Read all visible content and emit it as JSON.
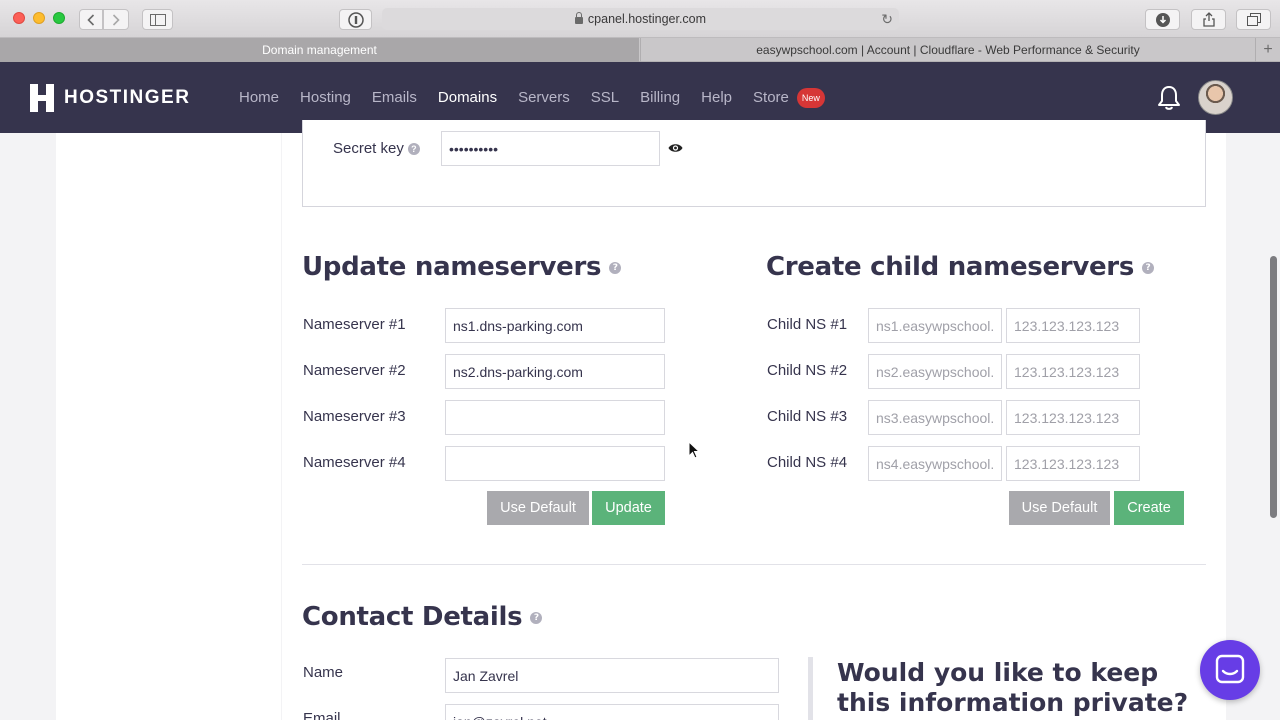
{
  "browser": {
    "url": "cpanel.hostinger.com",
    "tabs": [
      {
        "label": "Domain management",
        "active": true
      },
      {
        "label": "easywpschool.com | Account | Cloudflare - Web Performance & Security",
        "active": false
      }
    ]
  },
  "header": {
    "logo_text": "HOSTINGER",
    "nav": [
      "Home",
      "Hosting",
      "Emails",
      "Domains",
      "Servers",
      "SSL",
      "Billing",
      "Help",
      "Store"
    ],
    "current_nav": "Domains",
    "store_badge": "New"
  },
  "secret": {
    "label": "Secret key",
    "value": "••••••••••"
  },
  "nameservers": {
    "title": "Update nameservers",
    "rows": [
      {
        "label": "Nameserver #1",
        "value": "ns1.dns-parking.com"
      },
      {
        "label": "Nameserver #2",
        "value": "ns2.dns-parking.com"
      },
      {
        "label": "Nameserver #3",
        "value": ""
      },
      {
        "label": "Nameserver #4",
        "value": ""
      }
    ],
    "default_label": "Use Default",
    "update_label": "Update"
  },
  "child": {
    "title": "Create child nameservers",
    "rows": [
      {
        "label": "Child NS #1",
        "host_placeholder": "ns1.easywpschool.",
        "ip_placeholder": "123.123.123.123"
      },
      {
        "label": "Child NS #2",
        "host_placeholder": "ns2.easywpschool.",
        "ip_placeholder": "123.123.123.123"
      },
      {
        "label": "Child NS #3",
        "host_placeholder": "ns3.easywpschool.",
        "ip_placeholder": "123.123.123.123"
      },
      {
        "label": "Child NS #4",
        "host_placeholder": "ns4.easywpschool.",
        "ip_placeholder": "123.123.123.123"
      }
    ],
    "default_label": "Use Default",
    "create_label": "Create"
  },
  "contact": {
    "title": "Contact Details",
    "name_label": "Name",
    "name_value": "Jan Zavrel",
    "email_label": "Email",
    "email_value": "jan@zavrel.net",
    "privacy_prompt": "Would you like to keep this information private?"
  },
  "colors": {
    "header_bg": "#36344d",
    "green_button": "#5bb37a",
    "gray_button": "#a9a9ad",
    "chat_button": "#673de6",
    "badge": "#d63636"
  }
}
